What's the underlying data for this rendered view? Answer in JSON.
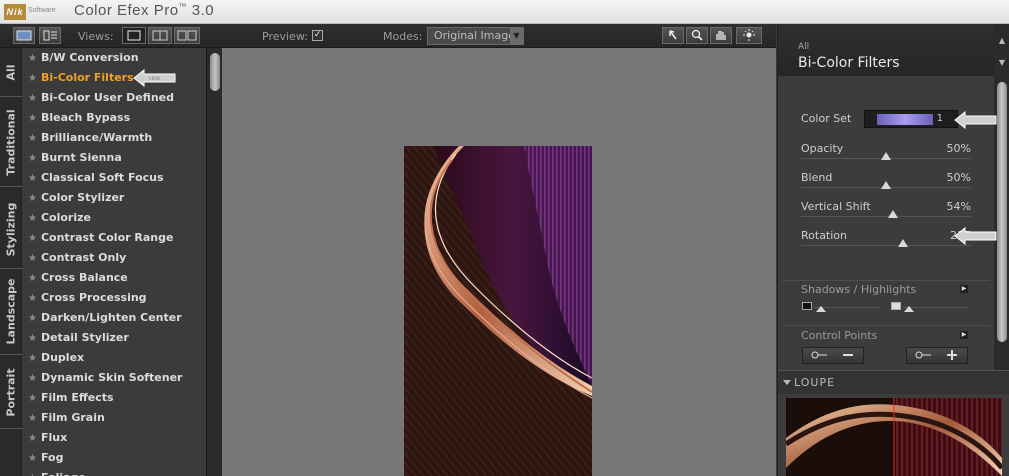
{
  "app": {
    "logo_text": "Nik",
    "logo_subtext": "Software",
    "title": "Color Efex Pro",
    "title_tm": "™",
    "version": "3.0"
  },
  "toolbar": {
    "views_label": "Views:",
    "preview_label": "Preview:",
    "preview_checked": "✓",
    "modes_label": "Modes:",
    "modes_value": "Original Image"
  },
  "vertical_tabs": [
    "All",
    "Traditional",
    "Stylizing",
    "Landscape",
    "Portrait"
  ],
  "filters": [
    "B/W Conversion",
    "Bi-Color Filters",
    "Bi-Color User Defined",
    "Bleach Bypass",
    "Brilliance/Warmth",
    "Burnt Sienna",
    "Classical Soft Focus",
    "Color Stylizer",
    "Colorize",
    "Contrast Color Range",
    "Contrast Only",
    "Cross Balance",
    "Cross Processing",
    "Darken/Lighten Center",
    "Detail Stylizer",
    "Duplex",
    "Dynamic Skin Softener",
    "Film Effects",
    "Film Grain",
    "Flux",
    "Fog",
    "Foliage"
  ],
  "active_filter_index": 1,
  "panel": {
    "category": "All",
    "title": "Bi-Color Filters",
    "color_set_label": "Color Set",
    "color_set_value": "1",
    "color_set_swatch": "#8f86de",
    "params": [
      {
        "label": "Opacity",
        "value": "50%",
        "fraction": 0.5
      },
      {
        "label": "Blend",
        "value": "50%",
        "fraction": 0.5
      },
      {
        "label": "Vertical Shift",
        "value": "54%",
        "fraction": 0.54
      },
      {
        "label": "Rotation",
        "value": "217",
        "fraction": 0.6
      }
    ],
    "shadows_highlights_label": "Shadows / Highlights",
    "control_points_label": "Control Points",
    "loupe_label": "LOUPE"
  },
  "colors": {
    "active_filter": "#f0a028",
    "titlebar_text": "#555555",
    "panel_bg": "#3c3c3c",
    "preview_bg": "#777777"
  }
}
